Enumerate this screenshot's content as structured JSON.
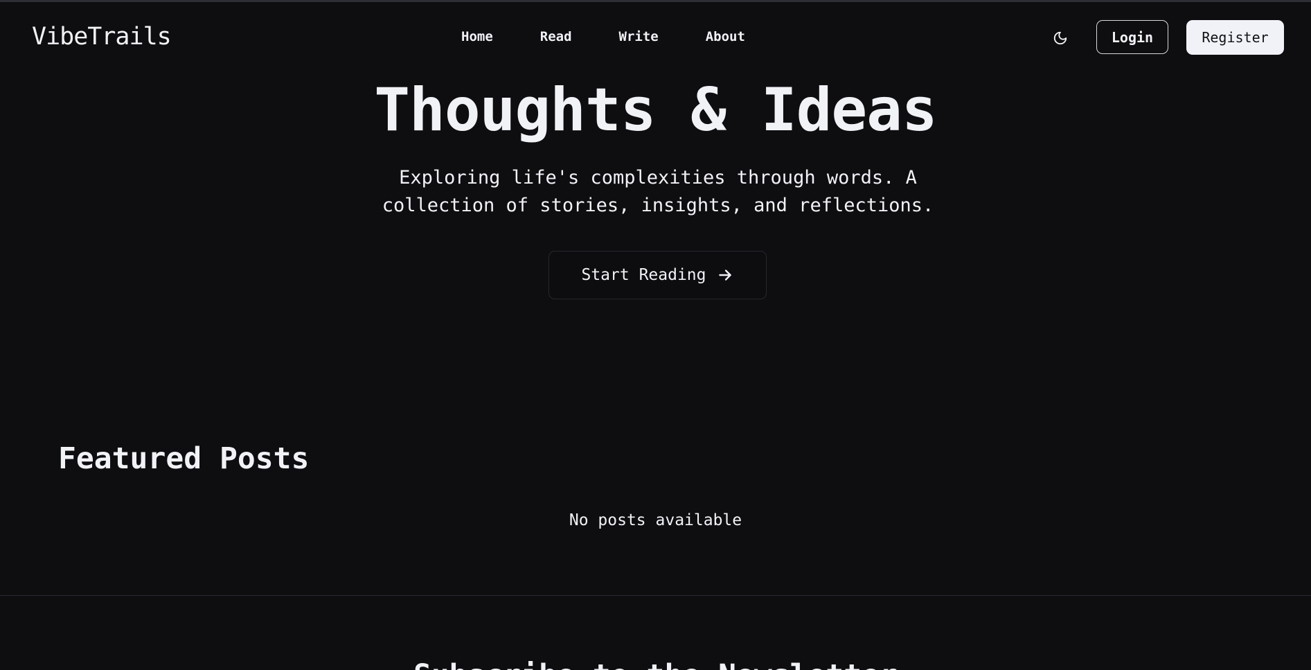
{
  "header": {
    "logo": "VibeTrails",
    "nav": [
      "Home",
      "Read",
      "Write",
      "About"
    ],
    "theme_icon": "moon-icon",
    "login_label": "Login",
    "register_label": "Register"
  },
  "hero": {
    "title": "Thoughts & Ideas",
    "subtitle": "Exploring life's complexities through words. A collection of stories, insights, and reflections.",
    "cta_label": "Start Reading",
    "cta_icon": "arrow-right-icon"
  },
  "featured": {
    "title": "Featured Posts",
    "empty_message": "No posts available"
  },
  "subscribe": {
    "title": "Subscribe to the Newsletter"
  },
  "colors": {
    "background": "#0e0e11",
    "text": "#f1f2f6",
    "register_bg": "#f1f2f8",
    "border": "#d8d9de"
  }
}
